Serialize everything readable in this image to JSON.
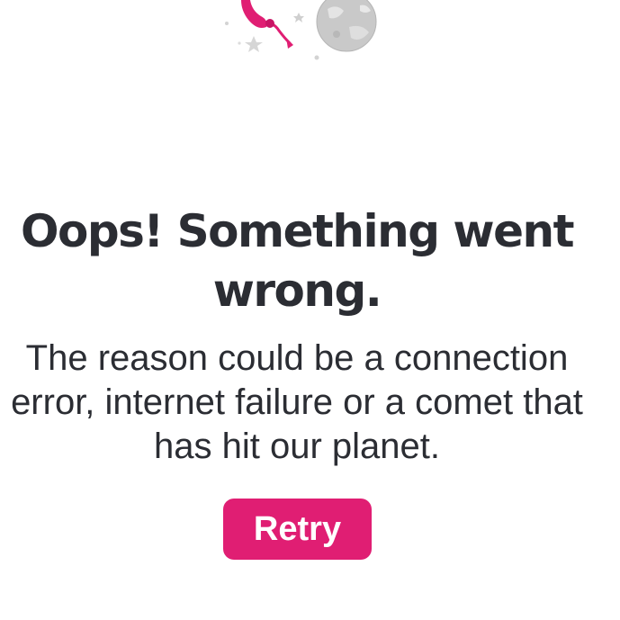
{
  "error": {
    "title": "Oops! Something went wrong.",
    "message": "The reason could be a connection error, internet failure or a comet that has hit our planet.",
    "retry_label": "Retry"
  },
  "colors": {
    "accent": "#e01e73",
    "text": "#2b2d33",
    "background": "#ffffff"
  },
  "icons": {
    "illustration": "astronaut-planet-illustration"
  }
}
